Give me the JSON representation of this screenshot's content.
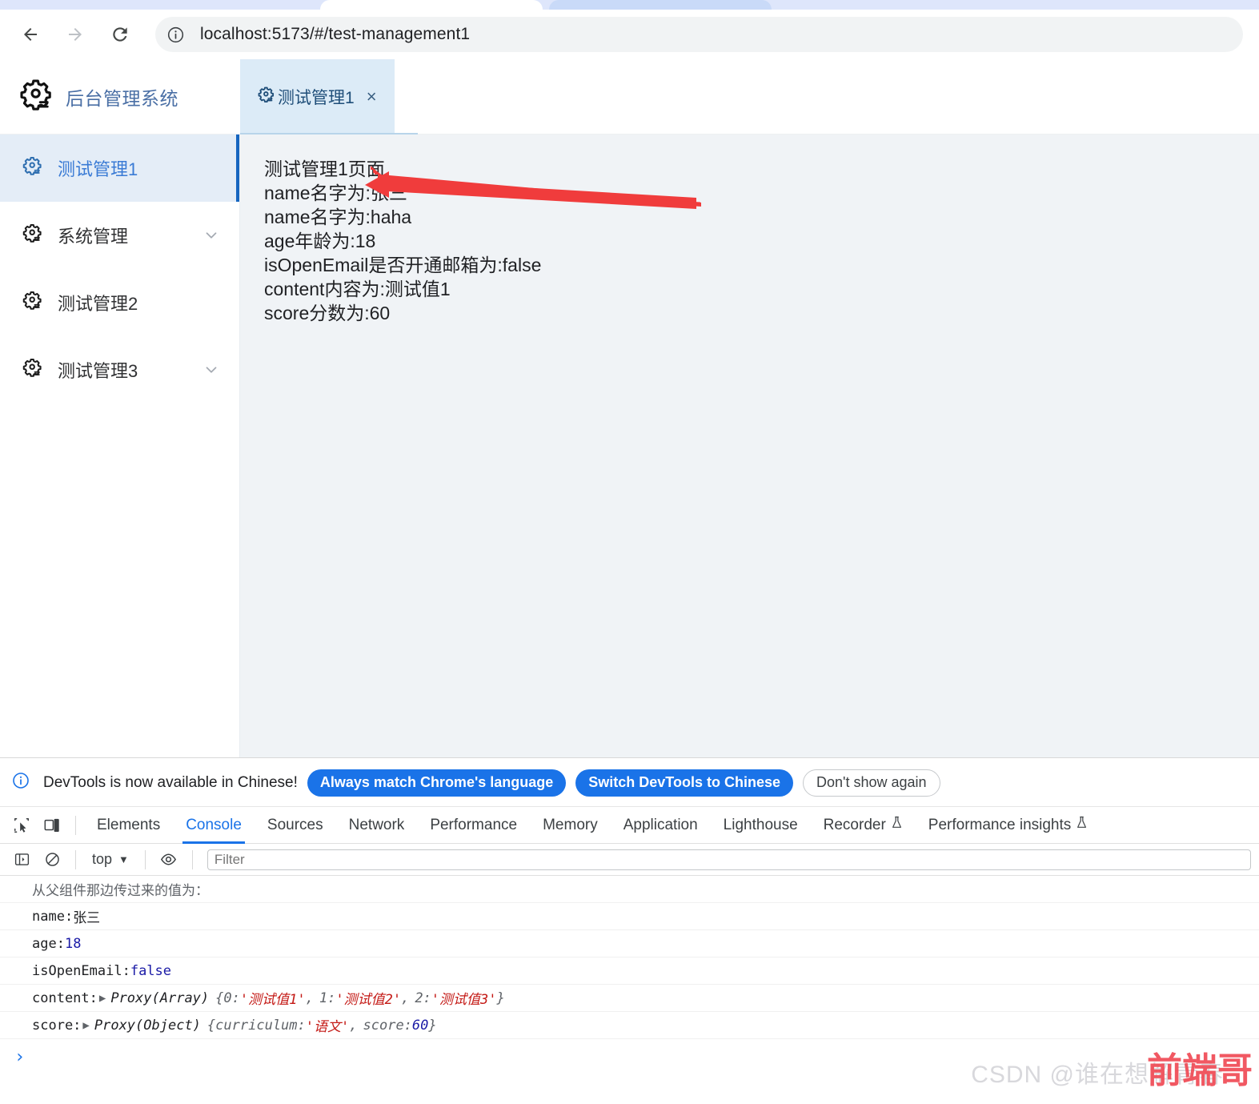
{
  "browser": {
    "back_label": "Back",
    "forward_label": "Forward",
    "reload_label": "Reload",
    "site_info_label": "View site information",
    "url": "localhost:5173/#/test-management1"
  },
  "app": {
    "logo_text": "后台管理系统",
    "logo_icon": "gear-icon",
    "tabs": [
      {
        "label": "测试管理1",
        "icon": "gear-icon",
        "close": "×",
        "active": true
      }
    ],
    "sidebar": {
      "items": [
        {
          "label": "测试管理1",
          "icon": "gear-icon",
          "active": true,
          "expandable": false
        },
        {
          "label": "系统管理",
          "icon": "gear-icon",
          "active": false,
          "expandable": true
        },
        {
          "label": "测试管理2",
          "icon": "gear-icon",
          "active": false,
          "expandable": false
        },
        {
          "label": "测试管理3",
          "icon": "gear-icon",
          "active": false,
          "expandable": true
        }
      ]
    },
    "content": {
      "lines": [
        "测试管理1页面",
        "name名字为:张三",
        "name名字为:haha",
        "age年龄为:18",
        "isOpenEmail是否开通邮箱为:false",
        "content内容为:测试值1",
        "score分数为:60"
      ],
      "annotation": {
        "type": "red-arrow",
        "color": "#f03c3c",
        "points_to_line": 2
      }
    }
  },
  "devtools": {
    "banner": {
      "icon": "info-icon",
      "text": "DevTools is now available in Chinese!",
      "buttons": [
        {
          "label": "Always match Chrome's language",
          "style": "primary"
        },
        {
          "label": "Switch DevTools to Chinese",
          "style": "primary"
        },
        {
          "label": "Don't show again",
          "style": "ghost"
        }
      ]
    },
    "toolbar_icons": [
      {
        "name": "inspect-element-icon"
      },
      {
        "name": "device-toolbar-icon"
      }
    ],
    "tabs": [
      {
        "label": "Elements",
        "selected": false,
        "beta": false
      },
      {
        "label": "Console",
        "selected": true,
        "beta": false
      },
      {
        "label": "Sources",
        "selected": false,
        "beta": false
      },
      {
        "label": "Network",
        "selected": false,
        "beta": false
      },
      {
        "label": "Performance",
        "selected": false,
        "beta": false
      },
      {
        "label": "Memory",
        "selected": false,
        "beta": false
      },
      {
        "label": "Application",
        "selected": false,
        "beta": false
      },
      {
        "label": "Lighthouse",
        "selected": false,
        "beta": false
      },
      {
        "label": "Recorder",
        "selected": false,
        "beta": true
      },
      {
        "label": "Performance insights",
        "selected": false,
        "beta": true
      }
    ],
    "console_bar": {
      "sidebar_toggle_icon": "console-sidebar-icon",
      "clear_icon": "clear-console-icon",
      "context": "top",
      "context_caret": "▼",
      "eye_icon": "live-expression-icon",
      "filter_placeholder": "Filter",
      "filter_value": ""
    },
    "console_log": [
      {
        "id": "header",
        "text": "从父组件那边传过来的值为：",
        "style": "muted"
      },
      {
        "id": "name",
        "key": "name: ",
        "value": "张三",
        "value_type": "text"
      },
      {
        "id": "age",
        "key": "age: ",
        "value": "18",
        "value_type": "number"
      },
      {
        "id": "isopen",
        "key": "isOpenEmail: ",
        "value": "false",
        "value_type": "number"
      },
      {
        "id": "content",
        "key": "content: ",
        "value_type": "proxy-array",
        "class_name": "Proxy(Array)",
        "open_brace": "{",
        "close_brace": "}",
        "entries": [
          {
            "k": "0: ",
            "v": "'测试值1'"
          },
          {
            "k": "1: ",
            "v": "'测试值2'"
          },
          {
            "k": "2: ",
            "v": "'测试值3'"
          }
        ]
      },
      {
        "id": "score",
        "key": "score: ",
        "value_type": "proxy-object",
        "class_name": "Proxy(Object)",
        "open_brace": "{",
        "close_brace": "}",
        "entries": [
          {
            "k": "curriculum: ",
            "v": "'语文'"
          },
          {
            "k": "score: ",
            "v": "60",
            "num": true
          }
        ]
      }
    ],
    "prompt_caret": "›"
  },
  "watermark": {
    "grey_text": "CSDN @谁在想解青春",
    "red_text": "前端哥"
  },
  "colors": {
    "accent_blue": "#1a73e8",
    "sidebar_active_bg": "#e4edf7",
    "sidebar_accent": "#1565c0",
    "content_bg": "#f0f3f6",
    "annotation_red": "#f03c3c",
    "string_red": "#c41a16",
    "number_blue": "#1a1aa6"
  }
}
